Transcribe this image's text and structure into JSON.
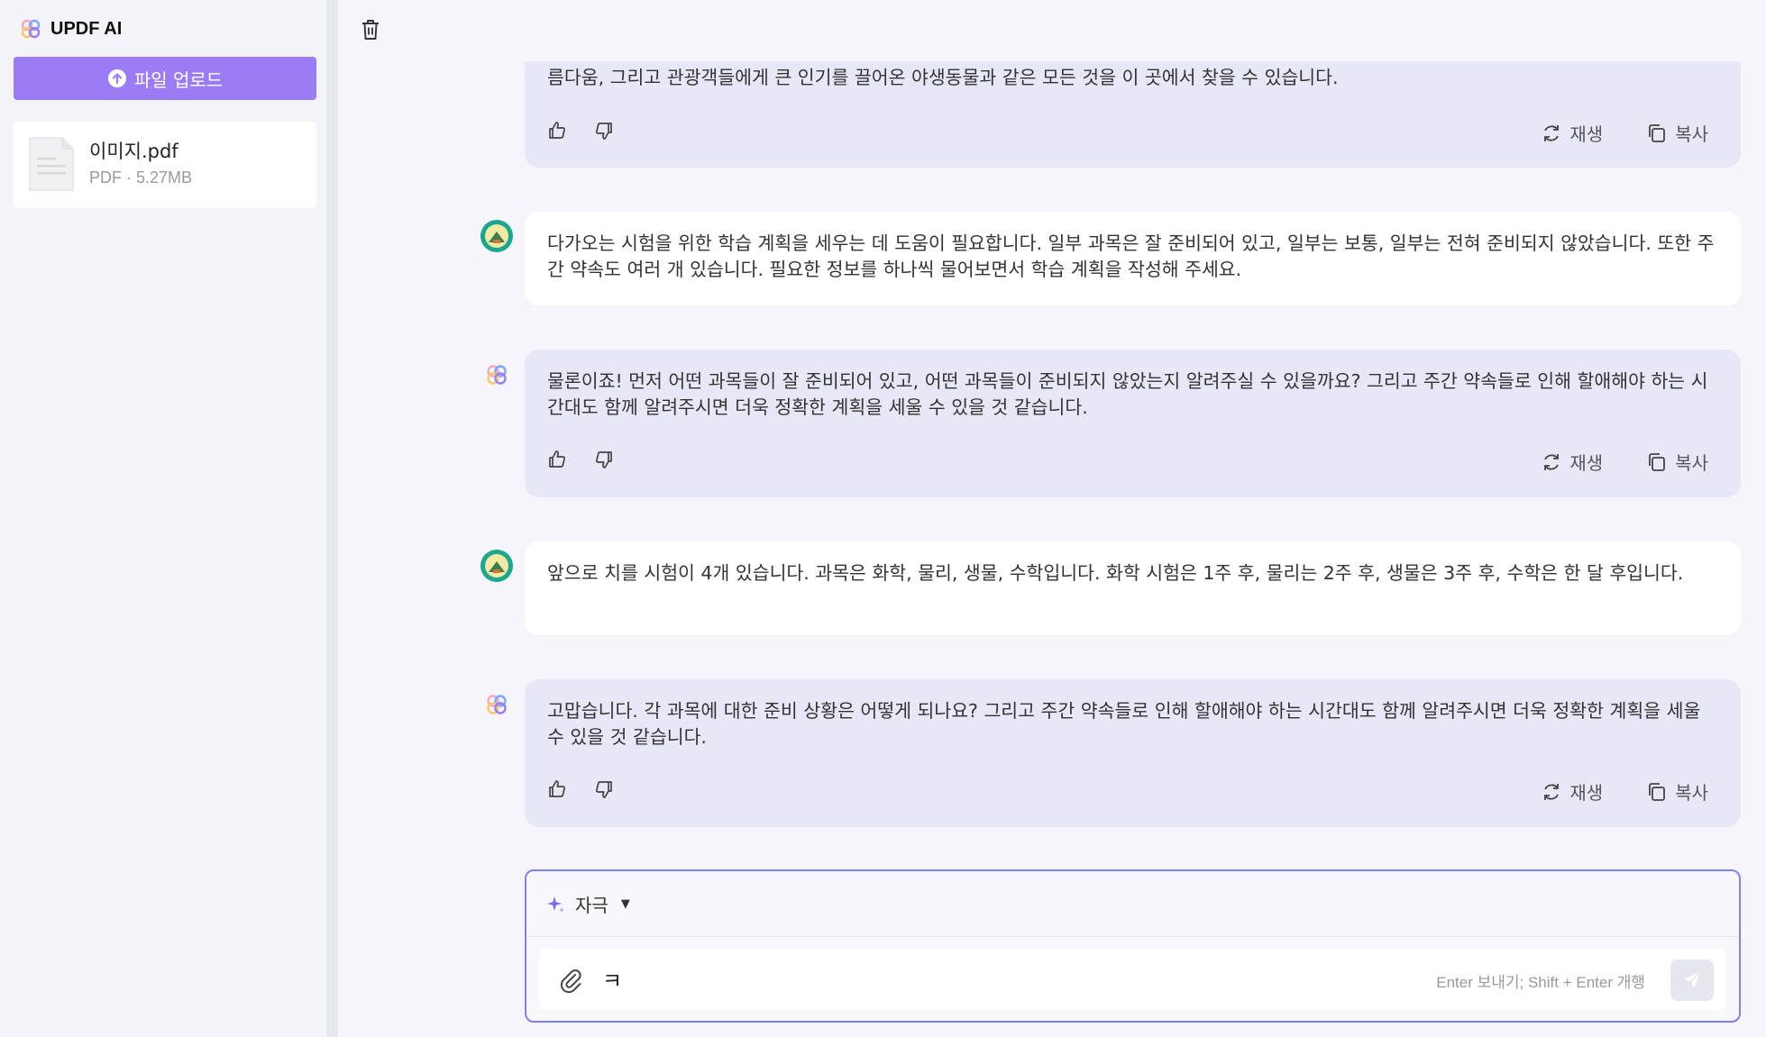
{
  "sidebar": {
    "brand": "UPDF AI",
    "upload_label": "파일 업로드",
    "file": {
      "name": "이미지.pdf",
      "meta": "PDF · 5.27MB"
    }
  },
  "messages": [
    {
      "role": "ai",
      "text": "름다움, 그리고 관광객들에게 큰 인기를 끌어온 야생동물과 같은 모든 것을 이 곳에서 찾을 수 있습니다."
    },
    {
      "role": "user",
      "text": "다가오는 시험을 위한 학습 계획을 세우는 데 도움이 필요합니다. 일부 과목은 잘 준비되어 있고, 일부는 보통, 일부는 전혀 준비되지 않았습니다. 또한 주간 약속도 여러 개 있습니다. 필요한 정보를 하나씩 물어보면서 학습 계획을 작성해 주세요."
    },
    {
      "role": "ai",
      "text": "물론이죠! 먼저 어떤 과목들이 잘 준비되어 있고, 어떤 과목들이 준비되지 않았는지 알려주실 수 있을까요? 그리고 주간 약속들로 인해 할애해야 하는 시간대도 함께 알려주시면 더욱 정확한 계획을 세울 수 있을 것 같습니다."
    },
    {
      "role": "user",
      "text": "앞으로 치를 시험이 4개 있습니다. 과목은 화학, 물리, 생물, 수학입니다. 화학 시험은 1주 후, 물리는 2주 후, 생물은 3주 후, 수학은 한 달 후입니다."
    },
    {
      "role": "ai",
      "text": "고맙습니다. 각 과목에 대한 준비 상황은 어떻게 되나요? 그리고 주간 약속들로 인해 할애해야 하는 시간대도 함께 알려주시면 더욱 정확한 계획을 세울 수 있을 것 같습니다."
    }
  ],
  "actions": {
    "regenerate": "재생",
    "copy": "복사"
  },
  "composer": {
    "mode": "자극",
    "typed": "ㅋ",
    "hint": "Enter 보내기; Shift + Enter 개행"
  },
  "colors": {
    "accent": "#9b7cf5",
    "ai_bubble": "#e8e7f7",
    "border": "#7f7ff0"
  }
}
